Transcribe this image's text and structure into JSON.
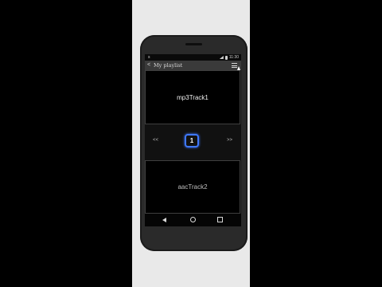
{
  "status": {
    "left_icon": "s",
    "time": "11:30"
  },
  "appbar": {
    "back_glyph": "<",
    "title": "My playlist"
  },
  "tracks": [
    {
      "label": "mp3Track1"
    },
    {
      "label": "aacTrack2"
    }
  ],
  "pager": {
    "prev_label": "<<",
    "page": "1",
    "next_label": ">>"
  },
  "colors": {
    "accent": "#3f78ff"
  }
}
